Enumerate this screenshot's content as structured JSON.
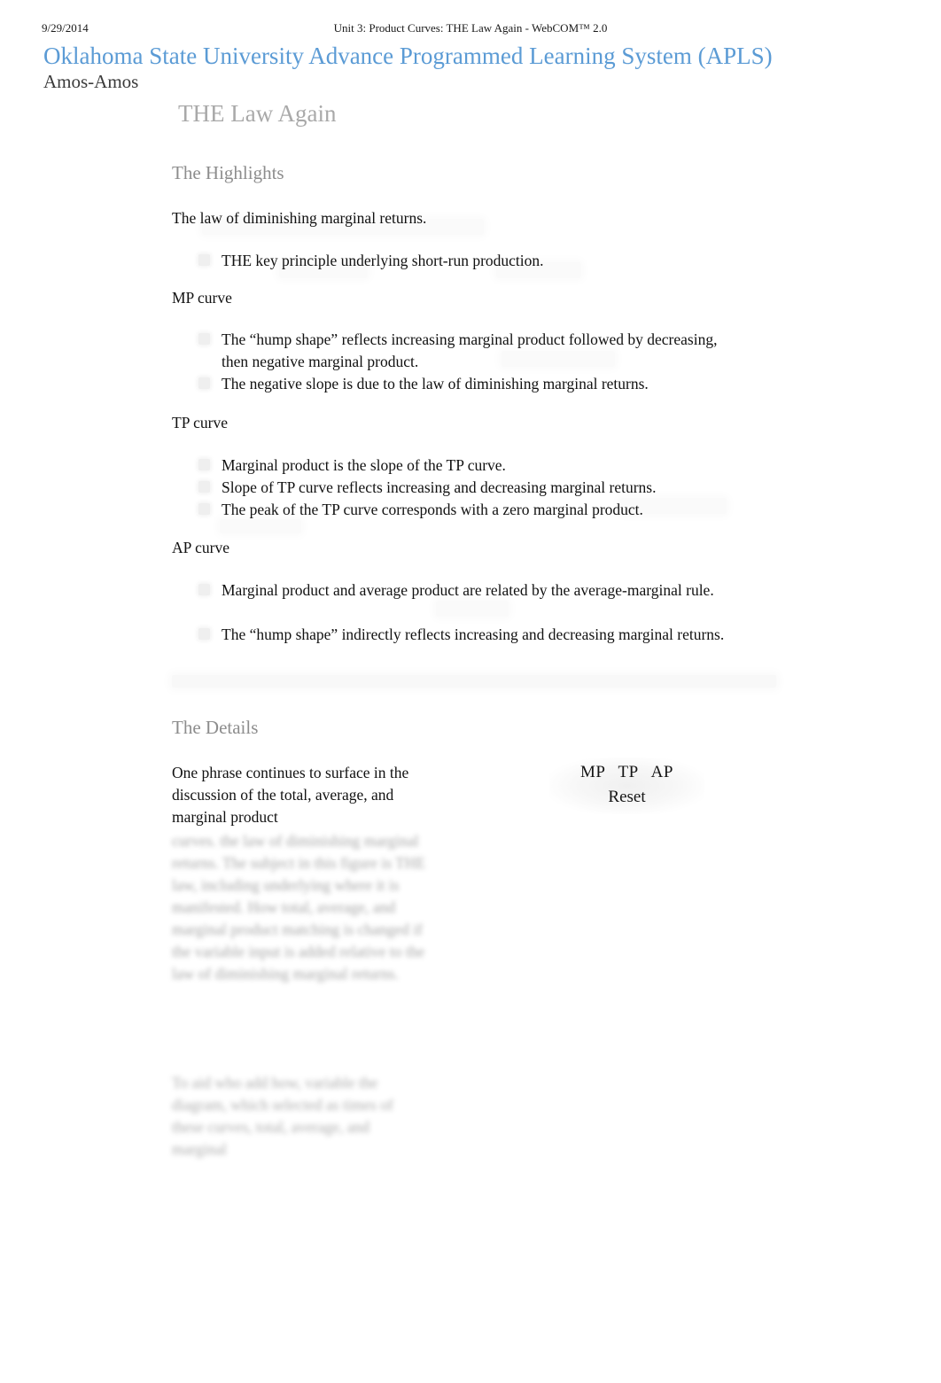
{
  "print_header": {
    "date": "9/29/2014",
    "title": "Unit 3: Product Curves: THE Law Again - WebCOM™ 2.0"
  },
  "site": {
    "title": "Oklahoma State University Advance Programmed Learning System (APLS)",
    "user": "Amos-Amos",
    "accent_color": "#5b9bd5"
  },
  "lesson": {
    "title": "THE Law Again",
    "title_color": "#a9a9a9"
  },
  "highlights": {
    "heading": "The Highlights",
    "lead": "The  law of diminishing marginal returns.",
    "lead_bullet": "THE key  principle underlying short-run     production.",
    "groups": [
      {
        "label": "MP curve",
        "items": [
          "The “hump shape” reflects increasing      marginal product followed by decreasing, then negative marginal product.",
          "The negative slope is due to the law of diminishing marginal returns."
        ]
      },
      {
        "label": "TP curve",
        "items": [
          "Marginal product is the slope of the TP curve.",
          "Slope of TP curve reflects increasing and      decreasing marginal returns.",
          "The  peak of the TP curve corresponds with a zero marginal product."
        ]
      },
      {
        "label": "AP curve",
        "items": [
          "Marginal product and average      product are related by the average-marginal rule.",
          "The “hump shape” indirectly reflects increasing and decreasing marginal returns."
        ]
      }
    ]
  },
  "details": {
    "heading": "The Details",
    "paragraph_visible": "One phrase continues to surface in the discussion of the total, average, and marginal product",
    "paragraph_blurred": "curves.  the law of diminishing marginal returns.  The subject in this figure is THE law, including underlying where it is manifested. How total, average, and marginal product matching is changed if the variable input is added relative to the law of diminishing marginal returns.",
    "paragraph_blurred_2": "To aid who add how, variable the diagram, which selected as times of these curves,  total, average, and marginal"
  },
  "controls": {
    "mp_label": "MP",
    "tp_label": "TP",
    "ap_label": "AP",
    "reset_label": "Reset"
  }
}
